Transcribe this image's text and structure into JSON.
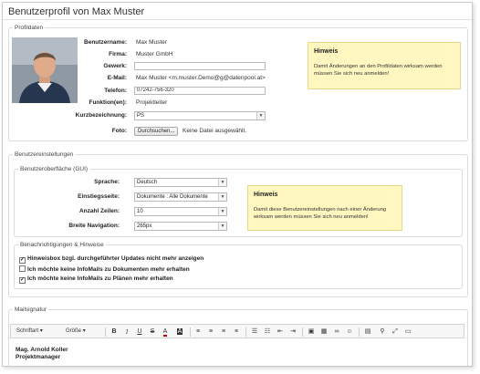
{
  "page": {
    "title": "Benutzerprofil von Max Muster"
  },
  "profile": {
    "legend": "Profildaten",
    "labels": {
      "username": "Benutzername:",
      "company": "Firma:",
      "trade": "Gewerk:",
      "email": "E-Mail:",
      "phone": "Telefon:",
      "function": "Funktion(en):",
      "shortname": "Kurzbezeichnung:",
      "photo": "Foto:"
    },
    "values": {
      "username": "Max Muster",
      "company": "Muster GmbH",
      "trade": "",
      "email": "Max Muster <m.muster.Demo@g@datenpool.at>",
      "phone": "07242-756-320",
      "function": "Projektleiter",
      "shortname": "PS"
    },
    "upload_button": "Durchsuchen...",
    "upload_status": "Keine Datei ausgewählt.",
    "hint": {
      "title": "Hinweis",
      "body_line1": "Damit Änderungen an den Profildaten wirksam werden",
      "body_line2": "müssen Sie sich neu anmelden!"
    }
  },
  "settings": {
    "legend": "Benutzereinstellungen",
    "gui": {
      "legend": "Benutzeroberfläche (GUI)",
      "labels": {
        "language": "Sprache:",
        "startpage": "Einstiegsseite:",
        "rows": "Anzahl Zeilen:",
        "navwidth": "Breite Navigation:"
      },
      "values": {
        "language": "Deutsch",
        "startpage": "Dokumente : Alle Dokumente",
        "rows": "10",
        "navwidth": "265px"
      },
      "hint": {
        "title": "Hinweis",
        "body_line1": "Damit diese Benutzereinstellungen nach einer Änderung",
        "body_line2": "wirksam werden müssen Sie sich neu anmelden!"
      }
    },
    "notifications": {
      "legend": "Benachrichtigungen & Hinweise",
      "items": [
        {
          "label": "Hinweisbox bzgl. durchgeführter Updates nicht mehr anzeigen",
          "checked": true,
          "mark": "✓"
        },
        {
          "label": "Ich möchte keine InfoMails zu Dokumenten mehr erhalten",
          "checked": false,
          "mark": ""
        },
        {
          "label": "Ich möchte keine InfoMails zu Plänen mehr erhalten",
          "checked": true,
          "mark": "✓"
        }
      ]
    }
  },
  "mail": {
    "legend": "Mailsignatur",
    "font_dropdown": "Schriftart",
    "size_dropdown": "Größe",
    "signature_line1": "Mag. Arnold Koller",
    "signature_line2": "Projektmanager"
  }
}
